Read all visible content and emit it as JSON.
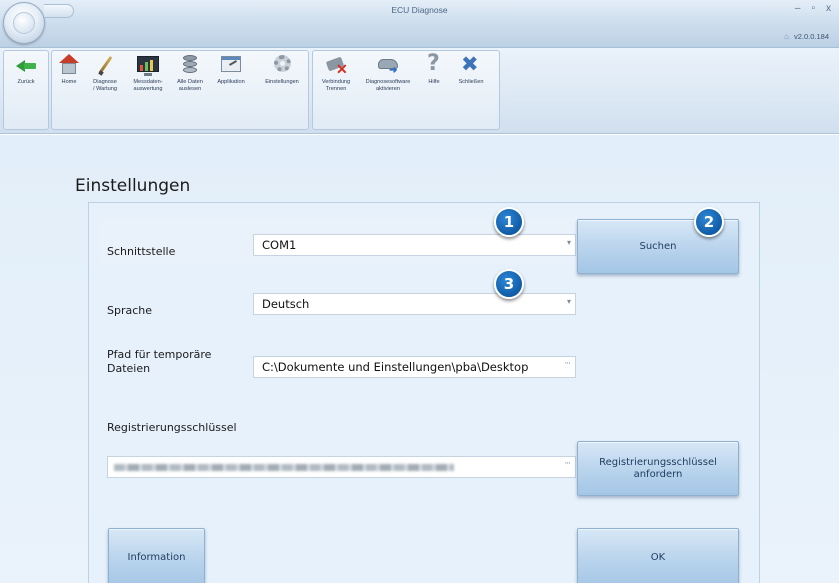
{
  "window": {
    "title": "ECU Diagnose",
    "version": "v2.0.0.184",
    "controls": [
      "–",
      "▫",
      "x"
    ]
  },
  "ribbon": {
    "groups": [
      {
        "buttons": [
          {
            "label": "Zurück",
            "icon": "back-arrow-icon"
          }
        ]
      },
      {
        "buttons": [
          {
            "label": "Home",
            "icon": "home-icon"
          },
          {
            "label": "Diagnose\n/ Wartung",
            "icon": "diagnosis-pen-icon"
          },
          {
            "label": "Messdaten-\nauswertung",
            "icon": "measurement-monitor-icon"
          },
          {
            "label": "Alle Daten\nauslesen",
            "icon": "database-icon"
          },
          {
            "label": "Applikation",
            "icon": "application-window-icon"
          },
          {
            "label": "Einstellungen",
            "icon": "gear-icon"
          }
        ]
      },
      {
        "buttons": [
          {
            "label": "Verbindung\nTrennen",
            "icon": "disconnect-icon"
          },
          {
            "label": "Diagnosesoftware\naktivieren",
            "icon": "activate-software-icon"
          },
          {
            "label": "Hilfe",
            "icon": "help-icon"
          },
          {
            "label": "Schließen",
            "icon": "close-tools-icon"
          }
        ]
      }
    ]
  },
  "settings": {
    "title": "Einstellungen",
    "interface": {
      "label": "Schnittstelle",
      "value": "COM1"
    },
    "language": {
      "label": "Sprache",
      "value": "Deutsch"
    },
    "temp_path": {
      "label": "Pfad für temporäre\nDateien",
      "value": "C:\\Dokumente und Einstellungen\\pba\\Desktop",
      "browse": "···"
    },
    "registration": {
      "label": "Registrierungsschlüssel",
      "browse": "···"
    },
    "buttons": {
      "search": "Suchen",
      "request_key": "Registrierungsschlüssel\nanfordern",
      "information": "Information",
      "ok": "OK"
    }
  },
  "callouts": [
    "1",
    "2",
    "3"
  ],
  "colors": {
    "callout": "#0f5ca8",
    "background": "#e6f1fb"
  }
}
